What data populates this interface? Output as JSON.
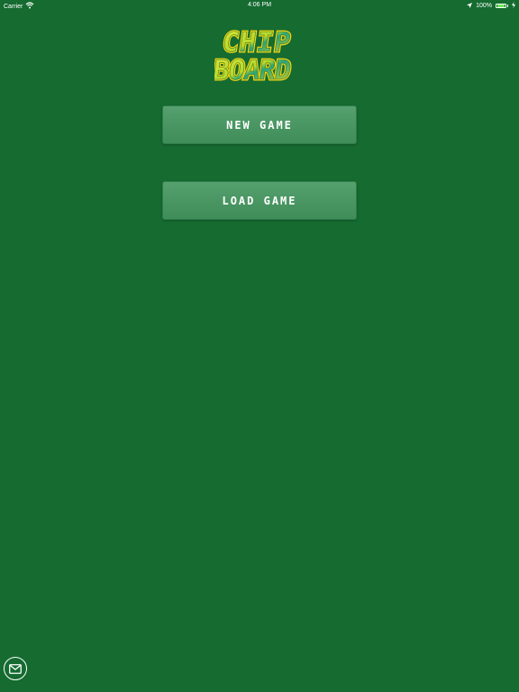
{
  "status_bar": {
    "carrier": "Carrier",
    "time": "4:06 PM",
    "battery": "100%",
    "battery_level": 1.0
  },
  "logo": {
    "text_line1": "CHIP",
    "text_line2": "BOARD",
    "colors": {
      "primary": "#c9e22a",
      "secondary": "#1f9c6c",
      "shadow": "#f3d614"
    }
  },
  "menu": {
    "new_game": "NEW GAME",
    "load_game": "LOAD GAME"
  },
  "colors": {
    "background": "#156b30",
    "button": "#4a9866",
    "text": "#ffffff"
  },
  "icons": {
    "mail": "mail-icon",
    "wifi": "wifi-icon",
    "location": "location-arrow-icon",
    "battery": "battery-icon",
    "charging": "charging-icon"
  }
}
